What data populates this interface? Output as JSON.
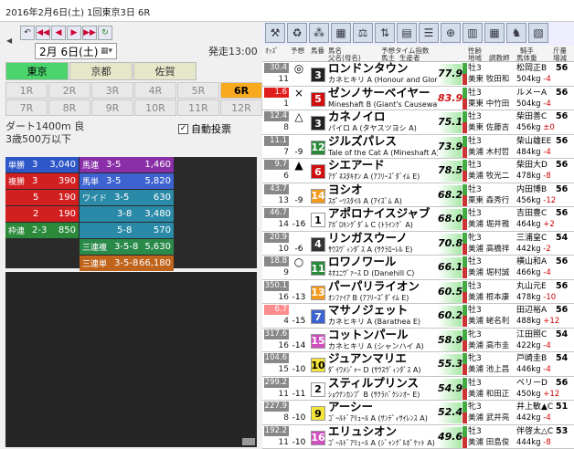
{
  "window": {
    "title": "2016年2月6日(土) 1回東京3日 6R"
  },
  "nav": {
    "date": "2月 6日(土)",
    "start_time": "発走13:00",
    "venues": [
      {
        "label": "東京",
        "active": true
      },
      {
        "label": "京都",
        "active": false
      },
      {
        "label": "佐賀",
        "active": false
      }
    ],
    "races": [
      {
        "label": "1R"
      },
      {
        "label": "2R"
      },
      {
        "label": "3R"
      },
      {
        "label": "4R"
      },
      {
        "label": "5R"
      },
      {
        "label": "6R",
        "active": true
      },
      {
        "label": "7R"
      },
      {
        "label": "8R"
      },
      {
        "label": "9R"
      },
      {
        "label": "10R"
      },
      {
        "label": "11R"
      },
      {
        "label": "12R"
      }
    ],
    "race_info": {
      "course": "ダート1400m 良",
      "class": "3歳500万以下"
    },
    "auto_vote_label": "自動投票",
    "auto_vote_checked": true
  },
  "odds": {
    "tansho": {
      "label": "単勝",
      "key": "3",
      "value": "3,040"
    },
    "fukusho": {
      "label": "複勝",
      "rows": [
        {
          "key": "3",
          "value": "390"
        },
        {
          "key": "5",
          "value": "190"
        },
        {
          "key": "2",
          "value": "190"
        }
      ]
    },
    "wakuren": {
      "label": "枠連",
      "key": "2-3",
      "value": "850"
    },
    "umaren": {
      "label": "馬連",
      "key": "3-5",
      "value": "1,460"
    },
    "umatan": {
      "label": "馬単",
      "key": "3-5",
      "value": "5,820"
    },
    "wide": {
      "label": "ワイド",
      "rows": [
        {
          "key": "3-5",
          "value": "630"
        },
        {
          "key": "3-8",
          "value": "3,480"
        },
        {
          "key": "5-8",
          "value": "570"
        }
      ]
    },
    "trio": {
      "label": "三連複",
      "key": "3-5-8",
      "value": "5,630"
    },
    "trifecta": {
      "label": "三連単",
      "key": "3-5-8",
      "value": "66,180"
    }
  },
  "table": {
    "headers": {
      "odds": "ｵｯｽﾞ",
      "pred": "予想",
      "num": "馬番",
      "name": "馬名",
      "parents": "父名(母名)",
      "pred_idx": "予想タイム指数",
      "sire": "馬主",
      "breeder": "生産者",
      "sex_age": "性齢",
      "stable": "地域",
      "trainer": "調教師",
      "jockey": "騎手",
      "weight": "馬体重",
      "kg": "斤量",
      "inc": "増減"
    },
    "rows": [
      {
        "odds": "30.4",
        "pop": "11",
        "mark": "◎",
        "trend": "",
        "num": "3",
        "num_bg": "#222",
        "num_fg": "#fff",
        "name": "ロンドンタウン",
        "sub": "カネヒキリ A (Honour and Glory A)",
        "score": "77.9",
        "age": "牡3",
        "stable": "美東 牧田和",
        "jockey": "松岡正B",
        "kg": "56",
        "weight": "504",
        "inc": "-4",
        "odds_style": "dark"
      },
      {
        "odds": "1.6",
        "pop": "1",
        "mark": "×",
        "trend": "",
        "num": "5",
        "num_bg": "#d01010",
        "num_fg": "#fff",
        "name": "ゼンノサーベイヤー",
        "sub": "Mineshaft B (Giant's Causeway A)",
        "score": "83.9",
        "age": "牡3",
        "stable": "栗東 中竹田",
        "jockey": "ルメーA",
        "kg": "56",
        "weight": "504",
        "inc": "-4",
        "odds_style": "fav",
        "score_style": "red"
      },
      {
        "odds": "12.4",
        "pop": "8",
        "mark": "△",
        "trend": "",
        "num": "3",
        "num_bg": "#222",
        "num_fg": "#fff",
        "name": "カネノイロ",
        "sub": "パイロ A (タヤスツヨシ A)",
        "score": "75.1",
        "age": "牡3",
        "stable": "美東 佐藤吉",
        "jockey": "柴田善C",
        "kg": "56",
        "weight": "456",
        "inc": "±0",
        "odds_style": "dark"
      },
      {
        "odds": "11.1",
        "pop": "7",
        "mark": "",
        "trend": "-9",
        "num": "12",
        "num_bg": "#2a8a3a",
        "num_fg": "#fff",
        "name": "ジルズパレス",
        "sub": "Tale of the Cat A (Mineshaft A)",
        "score": "73.9",
        "age": "牡3",
        "stable": "美浦 木村哲",
        "jockey": "柴山雄EE",
        "kg": "56",
        "weight": "484",
        "inc": "-4",
        "odds_style": "dark"
      },
      {
        "odds": "9.7",
        "pop": "6",
        "mark": "▲",
        "trend": "",
        "num": "6",
        "num_bg": "#d01010",
        "num_fg": "#fff",
        "name": "シエアード",
        "sub": "ｱｸﾞﾈｽﾀｷｵﾝ A (ｱﾌﾘｰｽﾞﾀﾞｲﾑ E)",
        "score": "78.5",
        "age": "牡3",
        "stable": "美浦 牧光二",
        "jockey": "柴田大D",
        "kg": "56",
        "weight": "478",
        "inc": "-8",
        "odds_style": "dark"
      },
      {
        "odds": "43.7",
        "pop": "13",
        "mark": "",
        "trend": "-9",
        "num": "14",
        "num_bg": "#f39a1e",
        "num_fg": "#fff",
        "name": "ヨシオ",
        "sub": "ｽﾎﾟｰﾂｽﾀｲﾙ A (ｱｲｽﾞﾑ A)",
        "score": "68.2",
        "age": "牡3",
        "stable": "栗東 森秀行",
        "jockey": "内田博B",
        "kg": "56",
        "weight": "456",
        "inc": "-12",
        "odds_style": "dark"
      },
      {
        "odds": "46.7",
        "pop": "14",
        "mark": "",
        "trend": "-16",
        "num": "1",
        "num_bg": "#fff",
        "num_fg": "#000",
        "name": "アポロナイスジャブ",
        "sub": "ｱﾎﾞﾛｷﾝｸﾞﾀﾞﾑ C (ﾄﾗｲﾝｸﾞ A)",
        "score": "68.0",
        "age": "牡3",
        "stable": "美浦 堀井雅",
        "jockey": "吉田豊C",
        "kg": "56",
        "weight": "464",
        "inc": "+2",
        "odds_style": "dark"
      },
      {
        "odds": "20.9",
        "pop": "10",
        "mark": "",
        "trend": "-6",
        "num": "4",
        "num_bg": "#333",
        "num_fg": "#fff",
        "name": "リンガスウーノ",
        "sub": "ｻｳｽｳﾞｨﾝﾀﾞｽ A (ｻｸﾗﾛｰﾚﾙ E)",
        "score": "70.8",
        "age": "牝3",
        "stable": "美浦 高橋祥",
        "jockey": "三浦皇C",
        "kg": "54",
        "weight": "442",
        "inc": "-2",
        "odds_style": "dark"
      },
      {
        "odds": "18.8",
        "pop": "9",
        "mark": "○",
        "trend": "",
        "num": "11",
        "num_bg": "#2a8a3a",
        "num_fg": "#fff",
        "name": "ロワノワール",
        "sub": "ﾈｵﾕﾆｳﾞｧｰｽ D (Danehill C)",
        "score": "66.1",
        "age": "牡3",
        "stable": "美浦 堀村誠",
        "jockey": "横山和A",
        "kg": "56",
        "weight": "466",
        "inc": "-4",
        "odds_style": "dark"
      },
      {
        "odds": "350.1",
        "pop": "16",
        "mark": "",
        "trend": "-13",
        "num": "13",
        "num_bg": "#f39a1e",
        "num_fg": "#fff",
        "name": "パーパリライオン",
        "sub": "ｵﾝﾌｧｲｱ B (ｱﾌﾘｰｽﾞﾀﾞｲﾑ E)",
        "score": "60.5",
        "age": "牡3",
        "stable": "美浦 根本康",
        "jockey": "丸山元E",
        "kg": "56",
        "weight": "478",
        "inc": "-10",
        "odds_style": "dark"
      },
      {
        "odds": "6.7",
        "pop": "4",
        "mark": "",
        "trend": "-15",
        "num": "7",
        "num_bg": "#3d63d0",
        "num_fg": "#fff",
        "name": "マサノジェット",
        "sub": "カネヒキリ A (Barathea E)",
        "score": "60.2",
        "age": "牡3",
        "stable": "美浦 蛯名利",
        "jockey": "田辺裕A",
        "kg": "56",
        "weight": "488",
        "inc": "+12",
        "odds_style": "sec"
      },
      {
        "odds": "317.6",
        "pop": "16",
        "mark": "",
        "trend": "-14",
        "num": "15",
        "num_bg": "#d04fbf",
        "num_fg": "#fff",
        "name": "コットンパール",
        "sub": "カネヒキリ A (シャンハイ A)",
        "score": "58.9",
        "age": "牝3",
        "stable": "美浦 高市圭",
        "jockey": "江田照C",
        "kg": "54",
        "weight": "422",
        "inc": "-4",
        "odds_style": "dark"
      },
      {
        "odds": "104.6",
        "pop": "15",
        "mark": "",
        "trend": "-10",
        "num": "10",
        "num_bg": "#f3e33a",
        "num_fg": "#000",
        "name": "ジュアンマリエ",
        "sub": "ﾀﾞｲﾜﾒｼﾞｬｰ D (ｻｳｽｳﾞｨﾝﾀﾞｽ A)",
        "score": "55.3",
        "age": "牝3",
        "stable": "美浦 池上昌",
        "jockey": "戸崎圭B",
        "kg": "54",
        "weight": "446",
        "inc": "-4",
        "odds_style": "dark"
      },
      {
        "odds": "299.2",
        "pop": "11",
        "mark": "",
        "trend": "-11",
        "num": "2",
        "num_bg": "#fff",
        "num_fg": "#000",
        "name": "スティルプリンス",
        "sub": "ｼｮｳﾅﾝｶﾝﾌﾟ B (ｻｸﾗﾊﾞｸｼﾝｵｰ E)",
        "score": "54.9",
        "age": "牡3",
        "stable": "美浦 和田正",
        "jockey": "ベリーD",
        "kg": "56",
        "weight": "450",
        "inc": "+12",
        "odds_style": "dark"
      },
      {
        "odds": "227.9",
        "pop": "8",
        "mark": "",
        "trend": "-10",
        "num": "9",
        "num_bg": "#f3e33a",
        "num_fg": "#000",
        "name": "アーシー",
        "sub": "ｺﾞｰﾙﾄﾞｱﾘｭｰﾙ A (ｻﾝﾃﾞｨｻｲﾚﾝｽ A)",
        "score": "52.4",
        "age": "牝3",
        "stable": "美浦 武井亮",
        "jockey": "井上敏▲C",
        "kg": "51",
        "weight": "442",
        "inc": "-4",
        "odds_style": "dark"
      },
      {
        "odds": "192.2",
        "pop": "11",
        "mark": "",
        "trend": "-10",
        "num": "16",
        "num_bg": "#d04fbf",
        "num_fg": "#fff",
        "name": "エリュシオン",
        "sub": "ｺﾞｰﾙﾄﾞｱﾘｭｰﾙ A (ｼﾞｬﾝｸﾞﾙﾎﾟｹｯﾄ A)",
        "score": "49.6",
        "age": "牡3",
        "stable": "美浦 田島俊",
        "jockey": "伴啓太△C",
        "kg": "53",
        "weight": "444",
        "inc": "-8",
        "odds_style": "dark"
      }
    ]
  }
}
